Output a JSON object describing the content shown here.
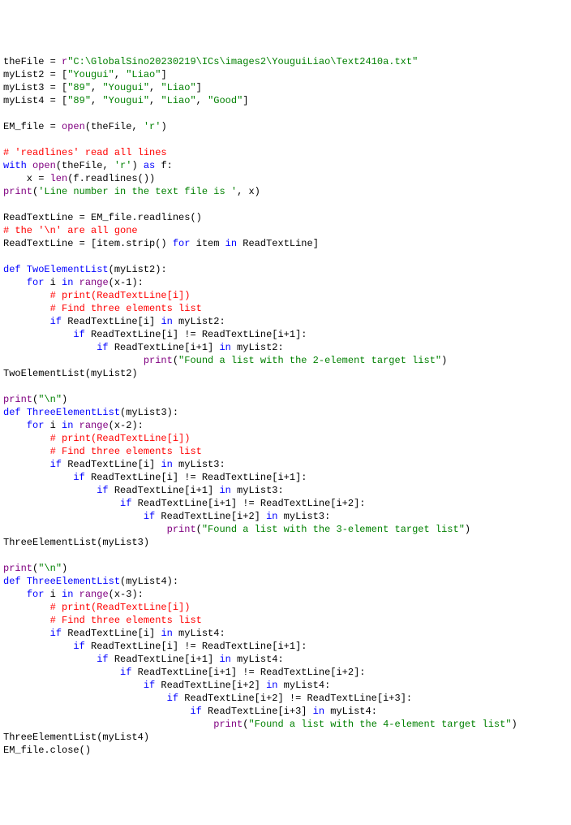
{
  "lines": [
    [
      [
        "id",
        "theFile = "
      ],
      [
        "raw",
        "r"
      ],
      [
        "str",
        "\"C:\\GlobalSino20230219\\ICs\\images2\\YouguiLiao\\Text2410a.txt\""
      ]
    ],
    [
      [
        "id",
        "myList2 = ["
      ],
      [
        "str",
        "\"Yougui\""
      ],
      [
        "id",
        ", "
      ],
      [
        "str",
        "\"Liao\""
      ],
      [
        "id",
        "]"
      ]
    ],
    [
      [
        "id",
        "myList3 = ["
      ],
      [
        "str",
        "\"89\""
      ],
      [
        "id",
        ", "
      ],
      [
        "str",
        "\"Yougui\""
      ],
      [
        "id",
        ", "
      ],
      [
        "str",
        "\"Liao\""
      ],
      [
        "id",
        "]"
      ]
    ],
    [
      [
        "id",
        "myList4 = ["
      ],
      [
        "str",
        "\"89\""
      ],
      [
        "id",
        ", "
      ],
      [
        "str",
        "\"Yougui\""
      ],
      [
        "id",
        ", "
      ],
      [
        "str",
        "\"Liao\""
      ],
      [
        "id",
        ", "
      ],
      [
        "str",
        "\"Good\""
      ],
      [
        "id",
        "]"
      ]
    ],
    [
      [
        "id",
        ""
      ]
    ],
    [
      [
        "id",
        "EM_file = "
      ],
      [
        "builtin",
        "open"
      ],
      [
        "id",
        "(theFile, "
      ],
      [
        "str",
        "'r'"
      ],
      [
        "id",
        ")"
      ]
    ],
    [
      [
        "id",
        ""
      ]
    ],
    [
      [
        "cmt",
        "# 'readlines' read all lines"
      ]
    ],
    [
      [
        "kw",
        "with"
      ],
      [
        "id",
        " "
      ],
      [
        "builtin",
        "open"
      ],
      [
        "id",
        "(theFile, "
      ],
      [
        "str",
        "'r'"
      ],
      [
        "id",
        ") "
      ],
      [
        "kw",
        "as"
      ],
      [
        "id",
        " f:"
      ]
    ],
    [
      [
        "id",
        "    x = "
      ],
      [
        "builtin",
        "len"
      ],
      [
        "id",
        "(f.readlines())"
      ]
    ],
    [
      [
        "builtin",
        "print"
      ],
      [
        "id",
        "("
      ],
      [
        "str",
        "'Line number in the text file is '"
      ],
      [
        "id",
        ", x)"
      ]
    ],
    [
      [
        "id",
        ""
      ]
    ],
    [
      [
        "id",
        "ReadTextLine = EM_file.readlines()"
      ]
    ],
    [
      [
        "cmt",
        "# the '\\n' are all gone"
      ]
    ],
    [
      [
        "id",
        "ReadTextLine = [item.strip() "
      ],
      [
        "kw",
        "for"
      ],
      [
        "id",
        " item "
      ],
      [
        "kw",
        "in"
      ],
      [
        "id",
        " ReadTextLine]"
      ]
    ],
    [
      [
        "id",
        ""
      ]
    ],
    [
      [
        "kw",
        "def"
      ],
      [
        "id",
        " "
      ],
      [
        "deffn",
        "TwoElementList"
      ],
      [
        "id",
        "(myList2):"
      ]
    ],
    [
      [
        "id",
        "    "
      ],
      [
        "kw",
        "for"
      ],
      [
        "id",
        " i "
      ],
      [
        "kw",
        "in"
      ],
      [
        "id",
        " "
      ],
      [
        "builtin",
        "range"
      ],
      [
        "id",
        "(x-1):"
      ]
    ],
    [
      [
        "id",
        "        "
      ],
      [
        "cmt",
        "# print(ReadTextLine[i])"
      ]
    ],
    [
      [
        "id",
        "        "
      ],
      [
        "cmt",
        "# Find three elements list"
      ]
    ],
    [
      [
        "id",
        "        "
      ],
      [
        "kw",
        "if"
      ],
      [
        "id",
        " ReadTextLine[i] "
      ],
      [
        "kw",
        "in"
      ],
      [
        "id",
        " myList2:"
      ]
    ],
    [
      [
        "id",
        "            "
      ],
      [
        "kw",
        "if"
      ],
      [
        "id",
        " ReadTextLine[i] != ReadTextLine[i+1]:"
      ]
    ],
    [
      [
        "id",
        "                "
      ],
      [
        "kw",
        "if"
      ],
      [
        "id",
        " ReadTextLine[i+1] "
      ],
      [
        "kw",
        "in"
      ],
      [
        "id",
        " myList2:"
      ]
    ],
    [
      [
        "id",
        "                        "
      ],
      [
        "builtin",
        "print"
      ],
      [
        "id",
        "("
      ],
      [
        "str",
        "\"Found a list with the 2-element target list\""
      ],
      [
        "id",
        ")"
      ]
    ],
    [
      [
        "id",
        "TwoElementList(myList2)"
      ]
    ],
    [
      [
        "id",
        ""
      ]
    ],
    [
      [
        "builtin",
        "print"
      ],
      [
        "id",
        "("
      ],
      [
        "str",
        "\"\\n\""
      ],
      [
        "id",
        ")"
      ]
    ],
    [
      [
        "kw",
        "def"
      ],
      [
        "id",
        " "
      ],
      [
        "deffn",
        "ThreeElementList"
      ],
      [
        "id",
        "(myList3):"
      ]
    ],
    [
      [
        "id",
        "    "
      ],
      [
        "kw",
        "for"
      ],
      [
        "id",
        " i "
      ],
      [
        "kw",
        "in"
      ],
      [
        "id",
        " "
      ],
      [
        "builtin",
        "range"
      ],
      [
        "id",
        "(x-2):"
      ]
    ],
    [
      [
        "id",
        "        "
      ],
      [
        "cmt",
        "# print(ReadTextLine[i])"
      ]
    ],
    [
      [
        "id",
        "        "
      ],
      [
        "cmt",
        "# Find three elements list"
      ]
    ],
    [
      [
        "id",
        "        "
      ],
      [
        "kw",
        "if"
      ],
      [
        "id",
        " ReadTextLine[i] "
      ],
      [
        "kw",
        "in"
      ],
      [
        "id",
        " myList3:"
      ]
    ],
    [
      [
        "id",
        "            "
      ],
      [
        "kw",
        "if"
      ],
      [
        "id",
        " ReadTextLine[i] != ReadTextLine[i+1]:"
      ]
    ],
    [
      [
        "id",
        "                "
      ],
      [
        "kw",
        "if"
      ],
      [
        "id",
        " ReadTextLine[i+1] "
      ],
      [
        "kw",
        "in"
      ],
      [
        "id",
        " myList3:"
      ]
    ],
    [
      [
        "id",
        "                    "
      ],
      [
        "kw",
        "if"
      ],
      [
        "id",
        " ReadTextLine[i+1] != ReadTextLine[i+2]:"
      ]
    ],
    [
      [
        "id",
        "                        "
      ],
      [
        "kw",
        "if"
      ],
      [
        "id",
        " ReadTextLine[i+2] "
      ],
      [
        "kw",
        "in"
      ],
      [
        "id",
        " myList3:"
      ]
    ],
    [
      [
        "id",
        "                            "
      ],
      [
        "builtin",
        "print"
      ],
      [
        "id",
        "("
      ],
      [
        "str",
        "\"Found a list with the 3-element target list\""
      ],
      [
        "id",
        ")"
      ]
    ],
    [
      [
        "id",
        "ThreeElementList(myList3)"
      ]
    ],
    [
      [
        "id",
        ""
      ]
    ],
    [
      [
        "builtin",
        "print"
      ],
      [
        "id",
        "("
      ],
      [
        "str",
        "\"\\n\""
      ],
      [
        "id",
        ")"
      ]
    ],
    [
      [
        "kw",
        "def"
      ],
      [
        "id",
        " "
      ],
      [
        "deffn",
        "ThreeElementList"
      ],
      [
        "id",
        "(myList4):"
      ]
    ],
    [
      [
        "id",
        "    "
      ],
      [
        "kw",
        "for"
      ],
      [
        "id",
        " i "
      ],
      [
        "kw",
        "in"
      ],
      [
        "id",
        " "
      ],
      [
        "builtin",
        "range"
      ],
      [
        "id",
        "(x-3):"
      ]
    ],
    [
      [
        "id",
        "        "
      ],
      [
        "cmt",
        "# print(ReadTextLine[i])"
      ]
    ],
    [
      [
        "id",
        "        "
      ],
      [
        "cmt",
        "# Find three elements list"
      ]
    ],
    [
      [
        "id",
        "        "
      ],
      [
        "kw",
        "if"
      ],
      [
        "id",
        " ReadTextLine[i] "
      ],
      [
        "kw",
        "in"
      ],
      [
        "id",
        " myList4:"
      ]
    ],
    [
      [
        "id",
        "            "
      ],
      [
        "kw",
        "if"
      ],
      [
        "id",
        " ReadTextLine[i] != ReadTextLine[i+1]:"
      ]
    ],
    [
      [
        "id",
        "                "
      ],
      [
        "kw",
        "if"
      ],
      [
        "id",
        " ReadTextLine[i+1] "
      ],
      [
        "kw",
        "in"
      ],
      [
        "id",
        " myList4:"
      ]
    ],
    [
      [
        "id",
        "                    "
      ],
      [
        "kw",
        "if"
      ],
      [
        "id",
        " ReadTextLine[i+1] != ReadTextLine[i+2]:"
      ]
    ],
    [
      [
        "id",
        "                        "
      ],
      [
        "kw",
        "if"
      ],
      [
        "id",
        " ReadTextLine[i+2] "
      ],
      [
        "kw",
        "in"
      ],
      [
        "id",
        " myList4:"
      ]
    ],
    [
      [
        "id",
        "                            "
      ],
      [
        "kw",
        "if"
      ],
      [
        "id",
        " ReadTextLine[i+2] != ReadTextLine[i+3]:"
      ]
    ],
    [
      [
        "id",
        "                                "
      ],
      [
        "kw",
        "if"
      ],
      [
        "id",
        " ReadTextLine[i+3] "
      ],
      [
        "kw",
        "in"
      ],
      [
        "id",
        " myList4:"
      ]
    ],
    [
      [
        "id",
        "                                    "
      ],
      [
        "builtin",
        "print"
      ],
      [
        "id",
        "("
      ],
      [
        "str",
        "\"Found a list with the 4-element target list\""
      ],
      [
        "id",
        ")"
      ]
    ],
    [
      [
        "id",
        "ThreeElementList(myList4)"
      ]
    ],
    [
      [
        "id",
        "EM_file.close()"
      ]
    ]
  ]
}
